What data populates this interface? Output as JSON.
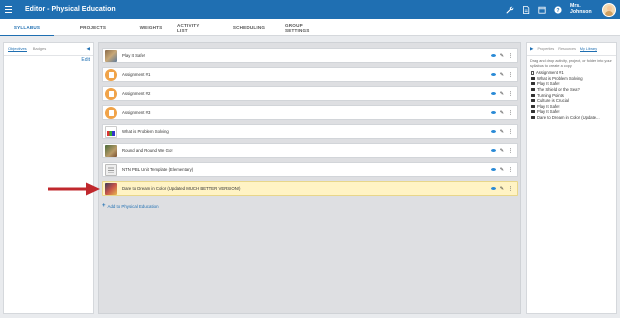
{
  "header": {
    "title": "Editor - Physical Education",
    "user_name": "Mrs. Johnson"
  },
  "tabs": [
    {
      "label": "SYLLABUS",
      "active": true
    },
    {
      "label": "PROJECTS"
    },
    {
      "label": "WEIGHTS"
    },
    {
      "label": "ACTIVITY LIST"
    },
    {
      "label": "SCHEDULING"
    },
    {
      "label": "GROUP SETTINGS"
    }
  ],
  "left_panel": {
    "tabs": [
      "Objectives",
      "Badges"
    ],
    "edit_label": "Edit"
  },
  "syllabus": {
    "items": [
      {
        "title": "Play It Safe!",
        "icon": "photo-thumbnail"
      },
      {
        "title": "Assignment #1",
        "icon": "assignment-icon"
      },
      {
        "title": "Assignment #2",
        "icon": "assignment-icon"
      },
      {
        "title": "Assignment #3",
        "icon": "assignment-icon"
      },
      {
        "title": "What is Problem Solving",
        "icon": "chart-thumbnail"
      },
      {
        "title": "Round and Round We Go!",
        "icon": "photo-thumbnail"
      },
      {
        "title": "NTN PBL Unit Template (Elementary)",
        "icon": "document-thumbnail"
      },
      {
        "title": "Dare to Dream in Color (Updated MUCH BETTER VERSION!)",
        "icon": "photo-thumbnail",
        "highlighted": true
      }
    ],
    "add_link": "Add to Physical Education"
  },
  "right_panel": {
    "tabs": [
      "Properties",
      "Resources",
      "My Library"
    ],
    "help_text": "Drag and drop activity, project, or folder into your syllabus to create a copy",
    "library": [
      {
        "label": "Assignment #1",
        "type": "page"
      },
      {
        "label": "What is Problem Solving",
        "type": "folder"
      },
      {
        "label": "Play It Safe!",
        "type": "folder"
      },
      {
        "label": "The Shield or the Sea?",
        "type": "folder"
      },
      {
        "label": "Turning Points",
        "type": "folder"
      },
      {
        "label": "Culture is Crucial",
        "type": "folder"
      },
      {
        "label": "Play It Safe!",
        "type": "folder"
      },
      {
        "label": "Play It Safe!",
        "type": "folder"
      },
      {
        "label": "Dare to Dream in Color (Update...",
        "type": "folder"
      }
    ]
  },
  "colors": {
    "brand": "#1f6fb2",
    "highlight_row": "#fff3c4",
    "assignment_icon": "#f0a349",
    "annotation_arrow": "#c0282d"
  }
}
